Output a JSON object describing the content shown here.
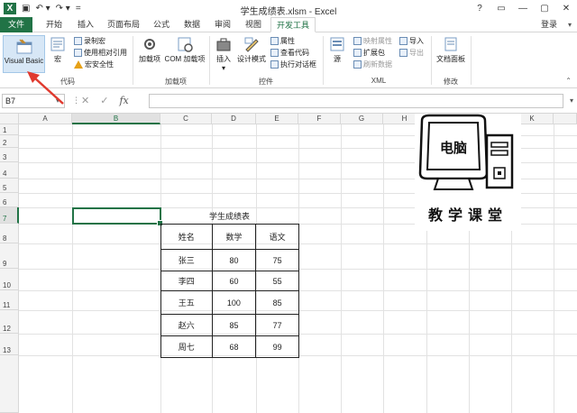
{
  "titlebar": {
    "app_icon": "X",
    "title": "学生成绩表.xlsm - Excel",
    "qat": [
      "save-icon",
      "undo-icon",
      "redo-icon",
      "customize-icon"
    ],
    "qat_glyphs": [
      "▣",
      "↶ ▾",
      "↷ ▾",
      "="
    ],
    "controls": [
      "?",
      "▭",
      "—",
      "▢",
      "✕"
    ]
  },
  "tabs": {
    "items": [
      "文件",
      "开始",
      "插入",
      "页面布局",
      "公式",
      "数据",
      "审阅",
      "视图",
      "开发工具"
    ],
    "active": "开发工具",
    "login": "登录"
  },
  "ribbon": {
    "groups": [
      {
        "label": "代码",
        "big": [
          "Visual Basic",
          "宏"
        ],
        "small": [
          "录制宏",
          "使用相对引用",
          "宏安全性"
        ]
      },
      {
        "label": "加载项",
        "big": [
          "加载项",
          "COM 加载项"
        ]
      },
      {
        "label": "控件",
        "big": [
          "插入",
          "设计模式"
        ],
        "small": [
          "属性",
          "查看代码",
          "执行对话框"
        ]
      },
      {
        "label": "XML",
        "big": [
          "源"
        ],
        "small": [
          "映射属性",
          "扩展包",
          "刷新数据",
          "导入",
          "导出"
        ]
      },
      {
        "label": "修改",
        "big": [
          "文档面板"
        ]
      }
    ]
  },
  "formula_bar": {
    "name_box": "B7",
    "cancel": "✕",
    "enter": "✓",
    "fx": "fx",
    "value": ""
  },
  "grid": {
    "columns": [
      "A",
      "B",
      "C",
      "D",
      "E",
      "F",
      "G",
      "H",
      "I",
      "J",
      "K"
    ],
    "rows": [
      "1",
      "2",
      "3",
      "4",
      "5",
      "6",
      "7",
      "8",
      "9",
      "10",
      "11",
      "12",
      "13"
    ],
    "selected_cell": "B7"
  },
  "table": {
    "title": "学生成绩表",
    "headers": [
      "姓名",
      "数学",
      "语文"
    ],
    "rows": [
      [
        "张三",
        "80",
        "75"
      ],
      [
        "李四",
        "60",
        "55"
      ],
      [
        "王五",
        "100",
        "85"
      ],
      [
        "赵六",
        "85",
        "77"
      ],
      [
        "周七",
        "68",
        "99"
      ]
    ]
  },
  "logo": {
    "screen_text": "电脑",
    "caption": "教学课堂"
  },
  "colors": {
    "excel_green": "#217346",
    "arrow_red": "#e03a2f"
  }
}
